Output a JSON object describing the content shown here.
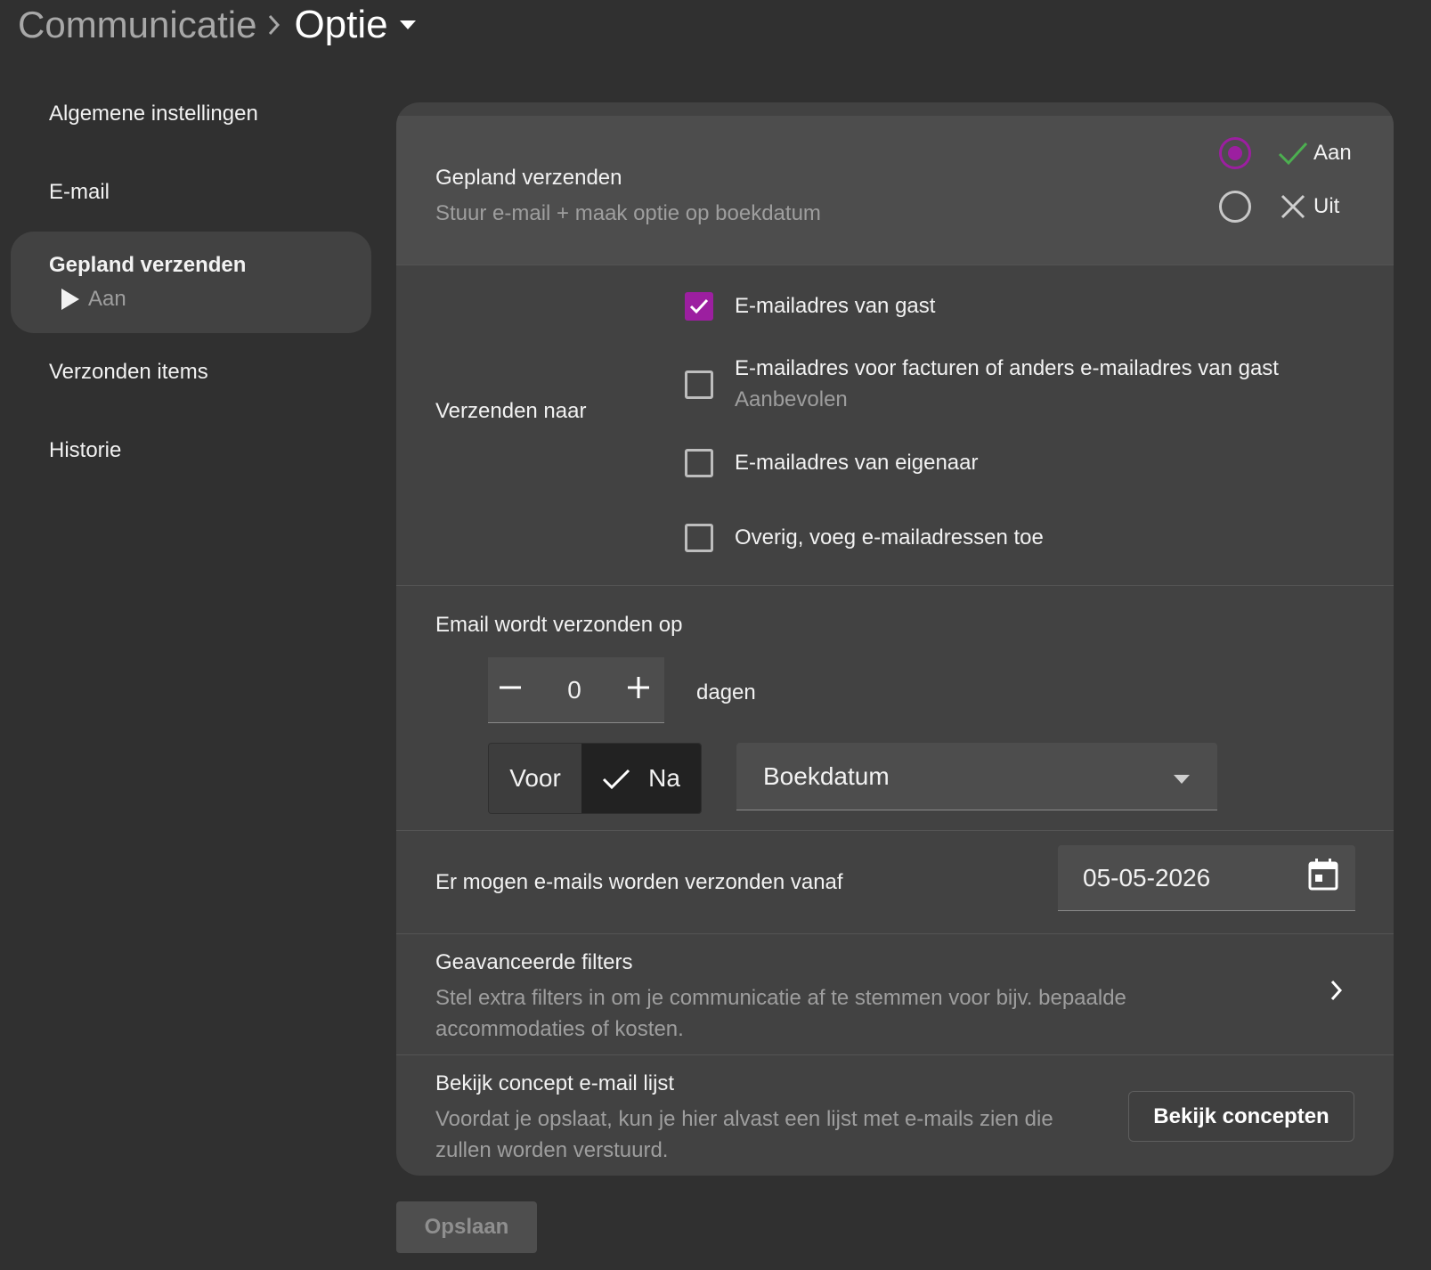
{
  "breadcrumb": {
    "root": "Communicatie",
    "current": "Optie"
  },
  "sidebar": {
    "items": [
      {
        "label": "Algemene instellingen"
      },
      {
        "label": "E-mail"
      },
      {
        "label": "Gepland verzenden",
        "sub": "Aan",
        "active": true
      },
      {
        "label": "Verzonden items"
      },
      {
        "label": "Historie"
      }
    ]
  },
  "gepland": {
    "title": "Gepland verzenden",
    "subtitle": "Stuur e-mail + maak optie op boekdatum",
    "on_label": "Aan",
    "off_label": "Uit",
    "selected": "Aan"
  },
  "recipients": {
    "label": "Verzenden naar",
    "options": [
      {
        "label": "E-mailadres van gast",
        "checked": true
      },
      {
        "label": "E-mailadres voor facturen of anders e-mailadres van gast",
        "hint": "Aanbevolen",
        "checked": false
      },
      {
        "label": "E-mailadres van eigenaar",
        "checked": false
      },
      {
        "label": "Overig, voeg e-mailadressen toe",
        "checked": false
      }
    ]
  },
  "timing": {
    "title": "Email wordt verzonden op",
    "days_value": "0",
    "days_unit": "dagen",
    "before_label": "Voor",
    "after_label": "Na",
    "selected": "Na",
    "reference": "Boekdatum"
  },
  "start": {
    "title": "Er mogen e-mails worden verzonden vanaf",
    "date": "05-05-2026"
  },
  "filters": {
    "title": "Geavanceerde filters",
    "subtitle": "Stel extra filters in om je communicatie af te stemmen voor bijv. bepaalde accommodaties of kosten."
  },
  "concept": {
    "title": "Bekijk concept e-mail lijst",
    "subtitle": "Voordat je opslaat, kun je hier alvast een lijst met e-mails zien die zullen worden verstuurd.",
    "button": "Bekijk concepten"
  },
  "save_label": "Opslaan",
  "colors": {
    "accent": "#9c1fa0",
    "check_green": "#4caf50",
    "background": "#303030",
    "card": "#424242"
  }
}
